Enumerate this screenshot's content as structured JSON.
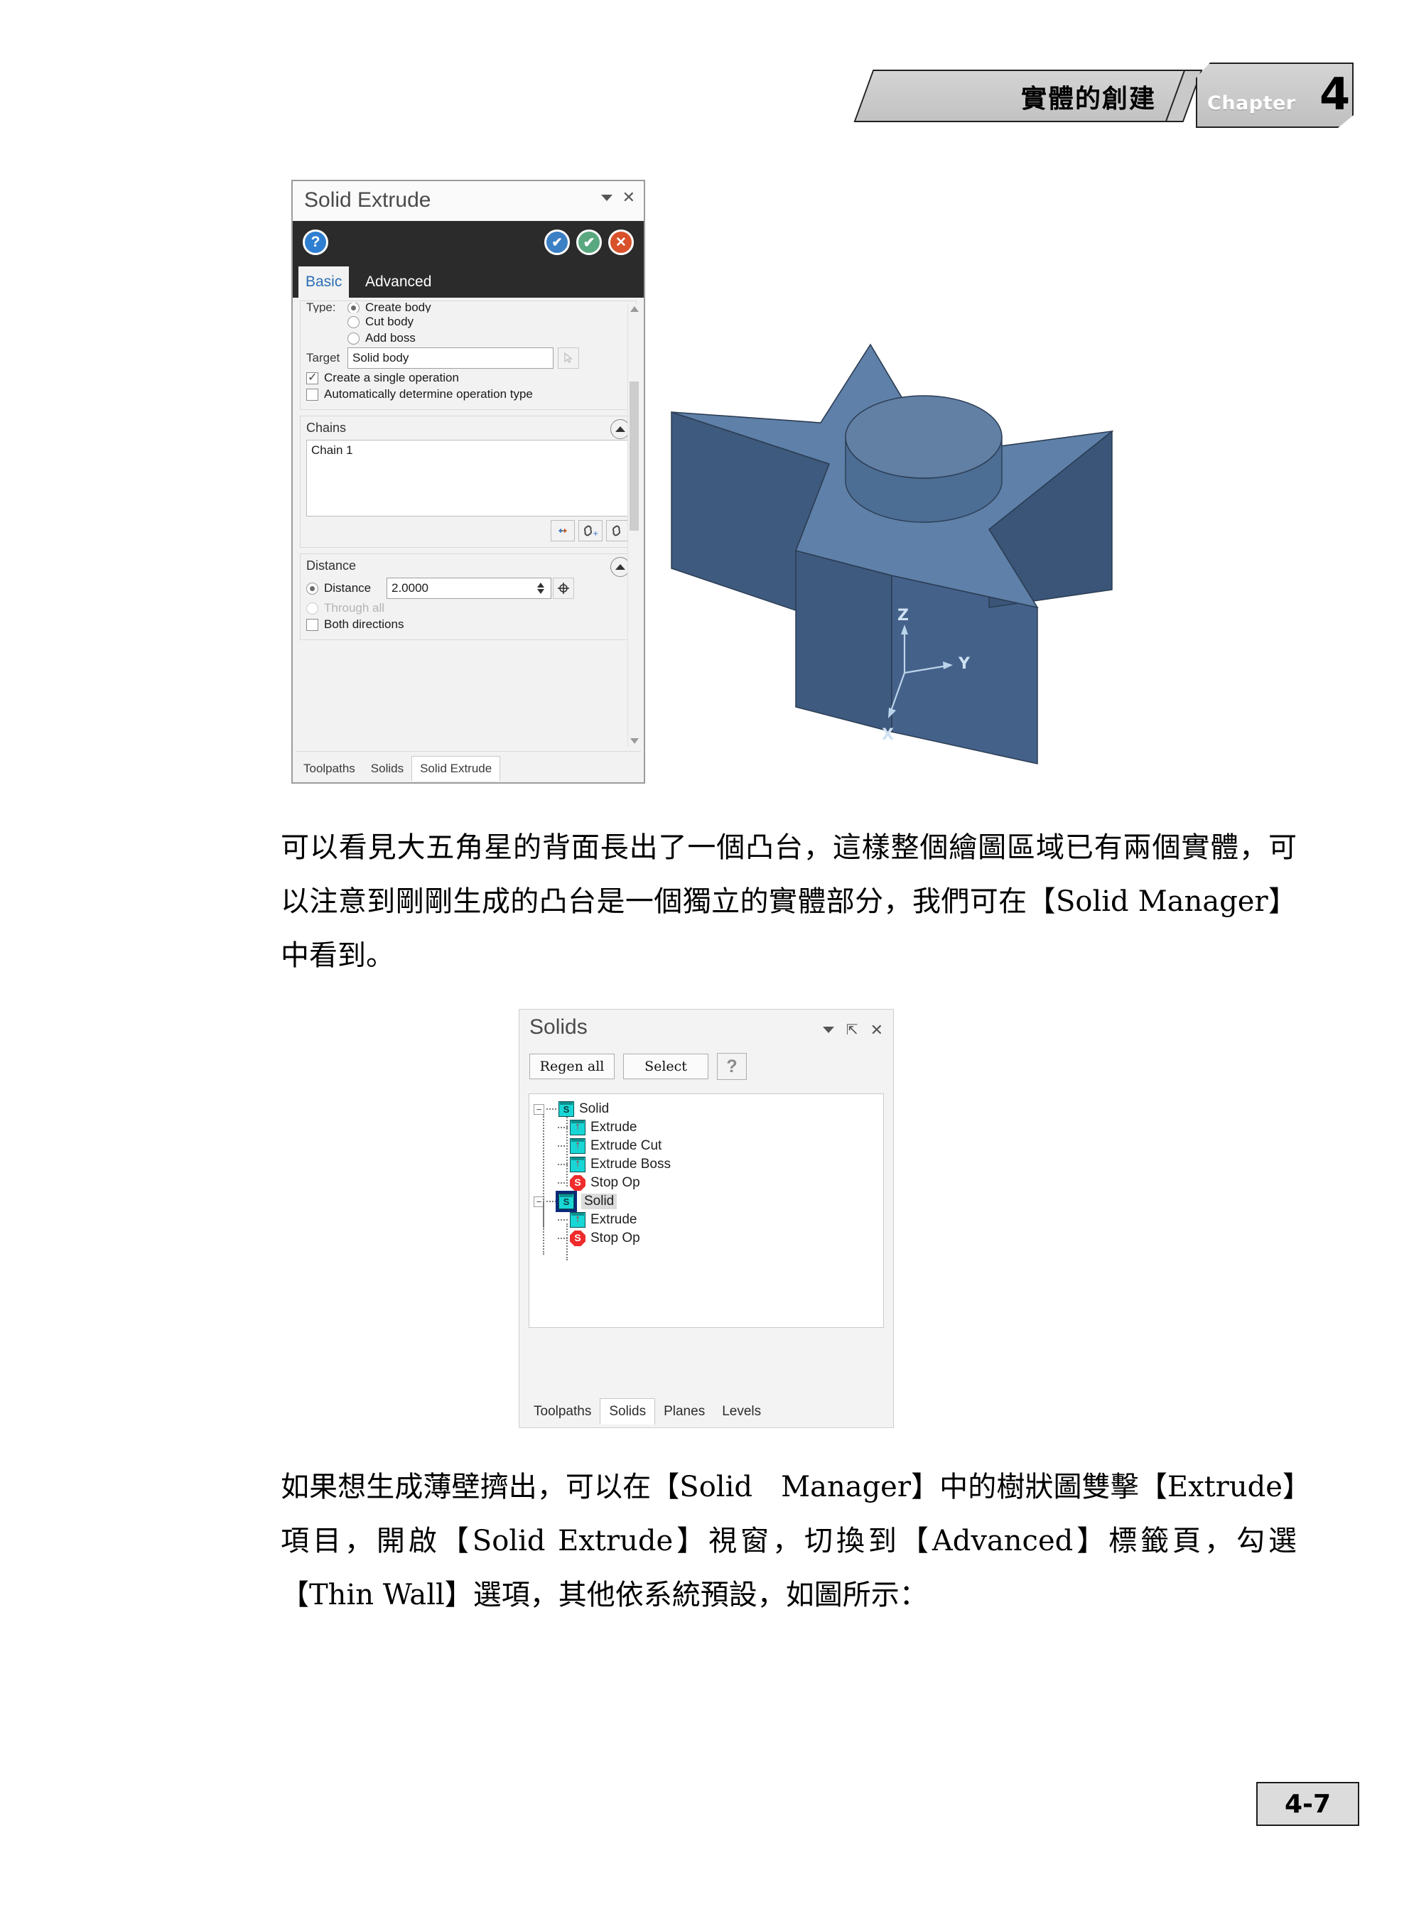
{
  "header": {
    "chapter_title": "實體的創建",
    "chapter_label": "Chapter",
    "chapter_number": "4"
  },
  "solid_extrude_dialog": {
    "title": "Solid Extrude",
    "icons": {
      "help": "?",
      "apply_new": "✔",
      "ok": "✔",
      "cancel": "✕",
      "caret": "▾",
      "close": "✕"
    },
    "tabs": [
      {
        "label": "Basic",
        "active": true
      },
      {
        "label": "Advanced",
        "active": false
      }
    ],
    "type_section": {
      "label": "Type:",
      "options": [
        {
          "label": "Create body",
          "selected": true
        },
        {
          "label": "Cut body",
          "selected": false
        },
        {
          "label": "Add boss",
          "selected": false
        }
      ]
    },
    "target": {
      "label": "Target",
      "value": "Solid body"
    },
    "checkboxes": [
      {
        "label": "Create a single operation",
        "checked": true
      },
      {
        "label": "Automatically determine operation type",
        "checked": false
      }
    ],
    "chains": {
      "title": "Chains",
      "items": [
        "Chain  1"
      ],
      "buttons": [
        "reverse-chain",
        "add-chain",
        "edit-chain"
      ]
    },
    "distance": {
      "title": "Distance",
      "radio_distance_label": "Distance",
      "value": "2.0000",
      "radio_through_all_label": "Through all",
      "through_all_enabled": false,
      "both_directions_label": "Both directions",
      "both_directions_checked": false
    },
    "bottom_tabs": [
      {
        "label": "Toolpaths",
        "active": false
      },
      {
        "label": "Solids",
        "active": false
      },
      {
        "label": "Solid Extrude",
        "active": true
      }
    ]
  },
  "model_view": {
    "axes": {
      "z": "Z",
      "y": "Y",
      "x": "X"
    },
    "colors": {
      "face_top": "#5f80a8",
      "face_side_dark": "#3f5a7d",
      "face_side_mid": "#4a6b91",
      "edge": "#2b3d54",
      "axis_text": "#bcd4ea"
    }
  },
  "paragraphs": {
    "p1": "可以看見大五角星的背面長出了一個凸台，這樣整個繪圖區域已有兩個實體，可以注意到剛剛生成的凸台是一個獨立的實體部分，我們可在【Solid Manager】中看到。",
    "p2": "如果想生成薄壁擠出，可以在【Solid　Manager】中的樹狀圖雙擊【Extrude】項目，開啟【Solid Extrude】視窗，切換到【Advanced】標籤頁，勾選【Thin Wall】選項，其他依系統預設，如圖所示："
  },
  "solids_panel": {
    "title": "Solids",
    "title_buttons": {
      "caret": "▾",
      "pin": "⇱",
      "close": "✕"
    },
    "toolbar": {
      "regen_all": "Regen all",
      "select": "Select",
      "help": "?"
    },
    "tree": [
      {
        "label": "Solid",
        "icon": "solid-icon",
        "level": 0,
        "expanded": true,
        "selected": false
      },
      {
        "label": "Extrude",
        "icon": "extrude-icon",
        "level": 1,
        "selected": false
      },
      {
        "label": "Extrude Cut",
        "icon": "extrude-icon",
        "level": 1,
        "selected": false
      },
      {
        "label": "Extrude Boss",
        "icon": "extrude-icon",
        "level": 1,
        "selected": false
      },
      {
        "label": "Stop Op",
        "icon": "stop-op-icon",
        "level": 1,
        "selected": false
      },
      {
        "label": "Solid",
        "icon": "solid-icon",
        "level": 0,
        "expanded": true,
        "selected": true
      },
      {
        "label": "Extrude",
        "icon": "extrude-icon",
        "level": 1,
        "selected": false
      },
      {
        "label": "Stop Op",
        "icon": "stop-op-icon",
        "level": 1,
        "selected": false
      }
    ],
    "tabs": [
      {
        "label": "Toolpaths",
        "active": false
      },
      {
        "label": "Solids",
        "active": true
      },
      {
        "label": "Planes",
        "active": false
      },
      {
        "label": "Levels",
        "active": false
      }
    ]
  },
  "footer": {
    "page_number": "4-7"
  }
}
